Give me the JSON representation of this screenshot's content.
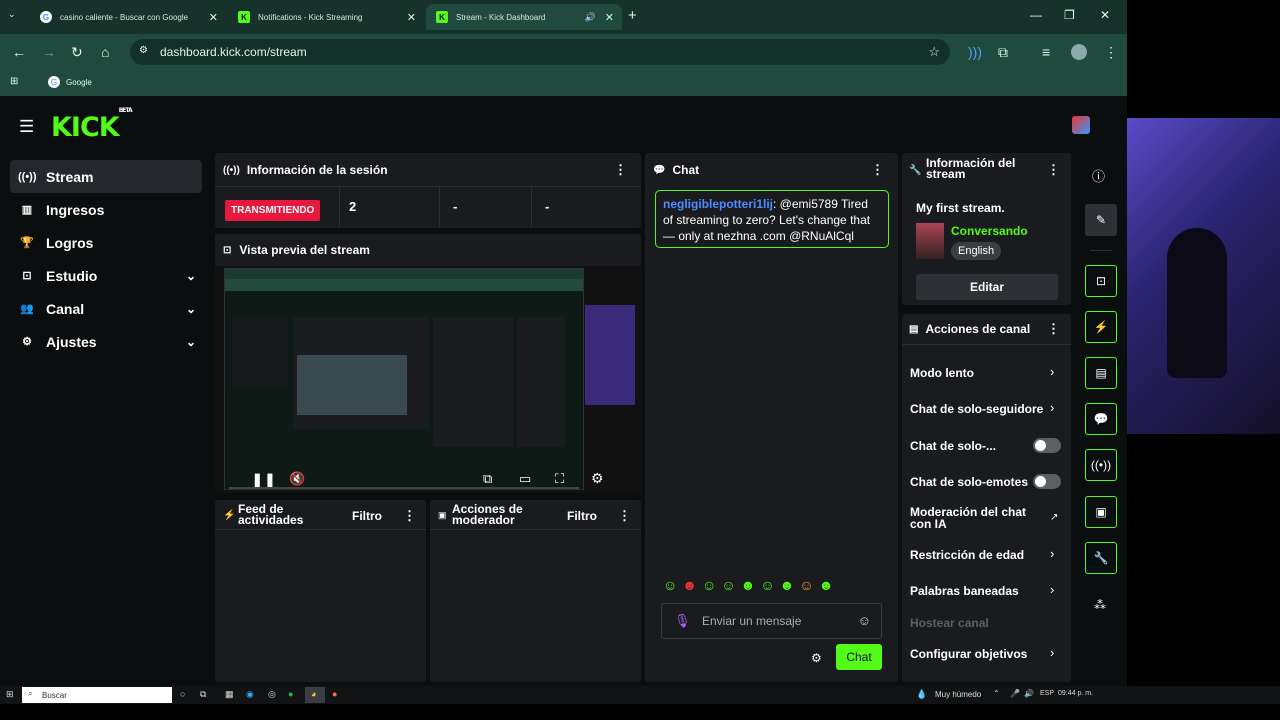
{
  "browser": {
    "tabs": [
      {
        "title": "casino caliente - Buscar con Google",
        "favicon": "google-icon"
      },
      {
        "title": "Notifications - Kick Streaming",
        "favicon": "kick-icon"
      },
      {
        "title": "Stream - Kick Dashboard",
        "favicon": "kick-icon"
      }
    ],
    "url": "dashboard.kick.com/stream",
    "bookmark": "Google"
  },
  "app": {
    "logo": "KICK",
    "logo_badge": "BETA"
  },
  "sidebar": {
    "items": [
      {
        "label": "Stream",
        "icon": "broadcast-icon"
      },
      {
        "label": "Ingresos",
        "icon": "chart-icon"
      },
      {
        "label": "Logros",
        "icon": "trophy-icon"
      },
      {
        "label": "Estudio",
        "icon": "studio-icon"
      },
      {
        "label": "Canal",
        "icon": "users-icon"
      },
      {
        "label": "Ajustes",
        "icon": "gear-icon"
      }
    ]
  },
  "session": {
    "title": "Información de la sesión",
    "status": "TRANSMITIENDO",
    "stat1": "2",
    "stat2": "-",
    "stat3": "-"
  },
  "preview": {
    "title": "Vista previa del stream"
  },
  "activity": {
    "title": "Feed de actividades",
    "filter": "Filtro"
  },
  "modactions": {
    "title": "Acciones de moderador",
    "filter": "Filtro"
  },
  "chat": {
    "title": "Chat",
    "message_user": "negligiblepotteri1lij",
    "message_text": ": @emi5789 Tired of streaming to zero? Let's change that — only at nezhna .com @RNuAlCql",
    "input_placeholder": "Enviar un mensaje",
    "send_label": "Chat"
  },
  "stream_info": {
    "title": "Información del stream",
    "stream_title": "My first stream.",
    "category": "Conversando",
    "language": "English",
    "edit_label": "Editar"
  },
  "channel_actions": {
    "title": "Acciones de canal",
    "slow_mode": "Modo lento",
    "followers_only": "Chat de solo-seguidore",
    "subs_only": "Chat de solo-...",
    "emotes_only": "Chat de solo-emotes",
    "ai_moderation": "Moderación del chat con IA",
    "age_restriction": "Restricción de edad",
    "banned_words": "Palabras baneadas",
    "host": "Hostear canal",
    "goals": "Configurar objetivos"
  },
  "taskbar": {
    "search": "Buscar",
    "weather": "Muy húmedo",
    "lang": "ESP",
    "time": "09:44 p. m."
  },
  "colors": {
    "accent": "#53fc18",
    "live": "#e8173d",
    "panel": "#191b1f"
  }
}
